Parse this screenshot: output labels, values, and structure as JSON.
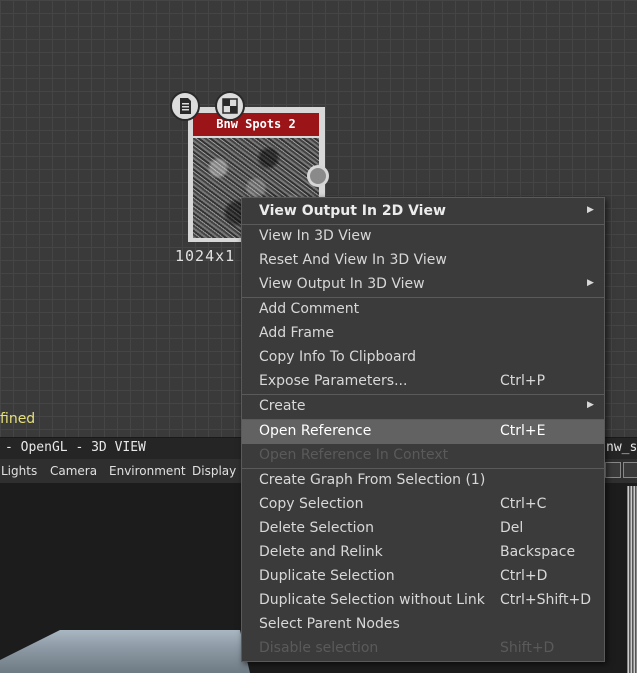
{
  "node": {
    "title": "Bnw Spots 2",
    "resolution": "1024x1",
    "left_icon": "document-icon",
    "right_icon": "checker-icon"
  },
  "status": {
    "text": "fined"
  },
  "view": {
    "title": "- OpenGL - 3D VIEW",
    "right_title": "nw_s",
    "menu": [
      "Lights",
      "Camera",
      "Environment",
      "Display"
    ]
  },
  "context_menu": {
    "items": [
      {
        "label": "View Output In 2D View",
        "shortcut": "",
        "submenu": true,
        "bold": true
      },
      {
        "label": "View In 3D View",
        "shortcut": ""
      },
      {
        "label": "Reset And View In 3D View",
        "shortcut": ""
      },
      {
        "label": "View Output In 3D View",
        "shortcut": "",
        "submenu": true
      },
      {
        "label": "Add Comment",
        "shortcut": ""
      },
      {
        "label": "Add Frame",
        "shortcut": ""
      },
      {
        "label": "Copy Info To Clipboard",
        "shortcut": ""
      },
      {
        "label": "Expose Parameters...",
        "shortcut": "Ctrl+P"
      },
      {
        "label": "Create",
        "shortcut": "",
        "submenu": true
      },
      {
        "label": "Open Reference",
        "shortcut": "Ctrl+E",
        "highlighted": true
      },
      {
        "label": "Open Reference In Context",
        "shortcut": "",
        "disabled": true
      },
      {
        "label": "Create Graph From Selection (1)",
        "shortcut": ""
      },
      {
        "label": "Copy Selection",
        "shortcut": "Ctrl+C"
      },
      {
        "label": "Delete Selection",
        "shortcut": "Del"
      },
      {
        "label": "Delete and Relink",
        "shortcut": "Backspace"
      },
      {
        "label": "Duplicate Selection",
        "shortcut": "Ctrl+D"
      },
      {
        "label": "Duplicate Selection without Link",
        "shortcut": "Ctrl+Shift+D"
      },
      {
        "label": "Select Parent Nodes",
        "shortcut": ""
      },
      {
        "label": "Disable selection",
        "shortcut": "Shift+D",
        "disabled": true
      }
    ]
  },
  "colors": {
    "node_title_bg": "#9a1418",
    "menu_bg": "#3b3b3b",
    "menu_highlight": "#626262",
    "status_text": "#e6e07a"
  }
}
